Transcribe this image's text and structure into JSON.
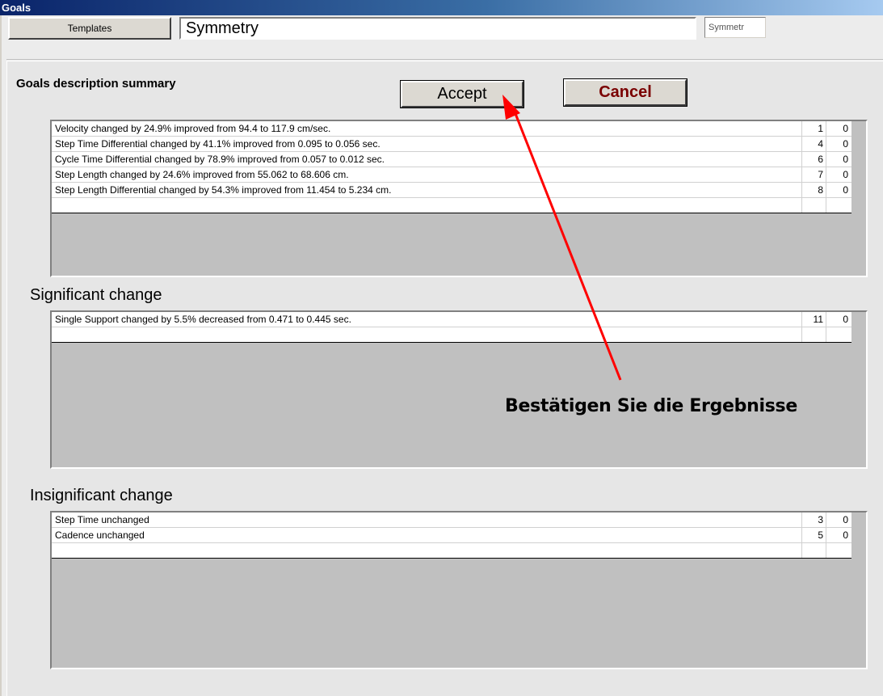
{
  "window": {
    "title": "Goals"
  },
  "toolbar": {
    "templates_label": "Templates",
    "name_value": "Symmetry",
    "short_value": "Symmetr"
  },
  "summary": {
    "title": "Goals description summary",
    "accept_label": "Accept",
    "cancel_label": "Cancel",
    "rows": [
      {
        "text": "Velocity  changed by 24.9% improved from 94.4 to 117.9 cm/sec.",
        "a": "1",
        "b": "0"
      },
      {
        "text": "Step Time Differential  changed by 41.1% improved from 0.095 to 0.056 sec.",
        "a": "4",
        "b": "0"
      },
      {
        "text": "Cycle Time Differential  changed by 78.9% improved from 0.057 to 0.012 sec.",
        "a": "6",
        "b": "0"
      },
      {
        "text": "Step Length  changed by 24.6% improved from 55.062 to 68.606 cm.",
        "a": "7",
        "b": "0"
      },
      {
        "text": "Step Length Differential  changed by 54.3% improved from 11.454 to 5.234 cm.",
        "a": "8",
        "b": "0"
      },
      {
        "text": "",
        "a": "",
        "b": ""
      }
    ]
  },
  "significant": {
    "title": "Significant change",
    "rows": [
      {
        "text": "Single Support  changed by 5.5% decreased from 0.471 to 0.445 sec.",
        "a": "11",
        "b": "0"
      },
      {
        "text": "",
        "a": "",
        "b": ""
      }
    ]
  },
  "insignificant": {
    "title": "Insignificant change",
    "rows": [
      {
        "text": "Step Time unchanged",
        "a": "3",
        "b": "0"
      },
      {
        "text": "Cadence unchanged",
        "a": "5",
        "b": "0"
      },
      {
        "text": "",
        "a": "",
        "b": ""
      }
    ]
  },
  "annotation": {
    "callout_text": "Bestätigen Sie die Ergebnisse",
    "arrow_color": "#ff0000"
  }
}
